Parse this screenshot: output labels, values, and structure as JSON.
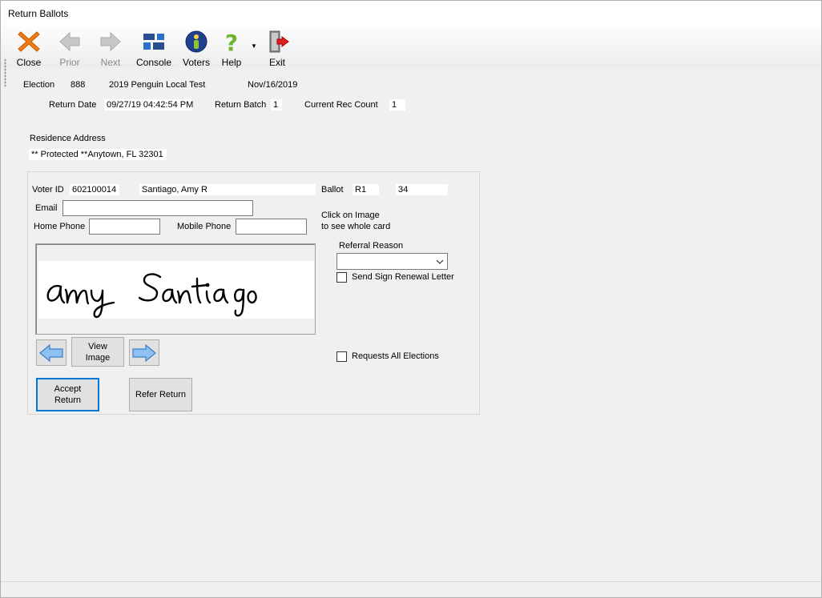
{
  "window": {
    "title": "Return Ballots"
  },
  "toolbar": {
    "close": "Close",
    "prior": "Prior",
    "next": "Next",
    "console": "Console",
    "voters": "Voters",
    "help": "Help",
    "exit": "Exit"
  },
  "election": {
    "label": "Election",
    "number": "888",
    "name": "2019 Penguin Local Test",
    "date": "Nov/16/2019"
  },
  "return_info": {
    "date_label": "Return Date",
    "date_value": "09/27/19 04:42:54 PM",
    "batch_label": "Return Batch",
    "batch_value": "1",
    "count_label": "Current Rec Count",
    "count_value": "1"
  },
  "residence": {
    "label": "Residence Address",
    "value": "** Protected **Anytown, FL 32301"
  },
  "voter": {
    "id_label": "Voter ID",
    "id_value": "602100014",
    "name_value": "Santiago, Amy R",
    "ballot_label": "Ballot",
    "ballot_value": "R1",
    "ballot_number": "34",
    "email_label": "Email",
    "email_value": "",
    "home_phone_label": "Home Phone",
    "home_phone_value": "",
    "mobile_phone_label": "Mobile Phone",
    "mobile_phone_value": ""
  },
  "image_hint": {
    "line1": "Click on Image",
    "line2": "to see whole card"
  },
  "signature": {
    "text": "Amy Santiago"
  },
  "referral": {
    "label": "Referral Reason",
    "selected": ""
  },
  "checkboxes": {
    "sign_renewal": "Send Sign Renewal Letter",
    "all_elections": "Requests All Elections"
  },
  "buttons": {
    "view_image_1": "View",
    "view_image_2": "Image",
    "accept_1": "Accept",
    "accept_2": "Return",
    "refer": "Refer Return"
  },
  "colors": {
    "accent": "#0078d7",
    "close_icon": "#f07a1a",
    "exit_arrow": "#e02020"
  }
}
